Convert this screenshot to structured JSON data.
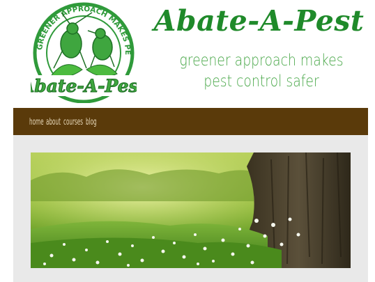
{
  "header": {
    "title": "Abate-A-Pest",
    "tagline": "greener approach makes pest control safer"
  },
  "logo": {
    "ring_text": "GREENER APPROACH MAKES PEST CONTROL SAFER",
    "wordmark": "Abate-A-Pest"
  },
  "nav": {
    "items": [
      {
        "label": "home"
      },
      {
        "label": "about"
      },
      {
        "label": "courses"
      },
      {
        "label": "blog"
      }
    ]
  },
  "colors": {
    "brand_green": "#1f8a2a",
    "nav_brown": "#5a3a0a",
    "content_bg": "#e9e9e9"
  }
}
